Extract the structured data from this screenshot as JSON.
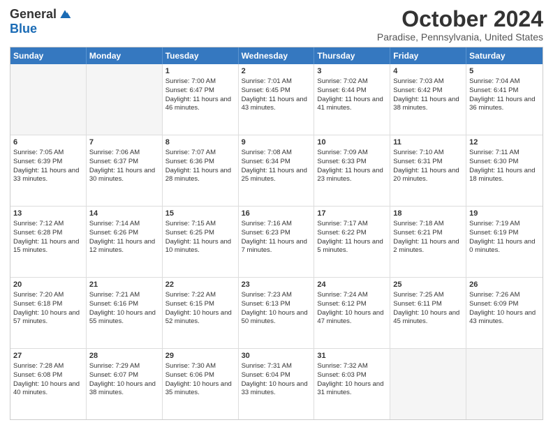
{
  "header": {
    "logo_general": "General",
    "logo_blue": "Blue",
    "month_title": "October 2024",
    "location": "Paradise, Pennsylvania, United States"
  },
  "days_of_week": [
    "Sunday",
    "Monday",
    "Tuesday",
    "Wednesday",
    "Thursday",
    "Friday",
    "Saturday"
  ],
  "weeks": [
    [
      {
        "day": "",
        "sunrise": "",
        "sunset": "",
        "daylight": "",
        "empty": true
      },
      {
        "day": "",
        "sunrise": "",
        "sunset": "",
        "daylight": "",
        "empty": true
      },
      {
        "day": "1",
        "sunrise": "Sunrise: 7:00 AM",
        "sunset": "Sunset: 6:47 PM",
        "daylight": "Daylight: 11 hours and 46 minutes."
      },
      {
        "day": "2",
        "sunrise": "Sunrise: 7:01 AM",
        "sunset": "Sunset: 6:45 PM",
        "daylight": "Daylight: 11 hours and 43 minutes."
      },
      {
        "day": "3",
        "sunrise": "Sunrise: 7:02 AM",
        "sunset": "Sunset: 6:44 PM",
        "daylight": "Daylight: 11 hours and 41 minutes."
      },
      {
        "day": "4",
        "sunrise": "Sunrise: 7:03 AM",
        "sunset": "Sunset: 6:42 PM",
        "daylight": "Daylight: 11 hours and 38 minutes."
      },
      {
        "day": "5",
        "sunrise": "Sunrise: 7:04 AM",
        "sunset": "Sunset: 6:41 PM",
        "daylight": "Daylight: 11 hours and 36 minutes."
      }
    ],
    [
      {
        "day": "6",
        "sunrise": "Sunrise: 7:05 AM",
        "sunset": "Sunset: 6:39 PM",
        "daylight": "Daylight: 11 hours and 33 minutes."
      },
      {
        "day": "7",
        "sunrise": "Sunrise: 7:06 AM",
        "sunset": "Sunset: 6:37 PM",
        "daylight": "Daylight: 11 hours and 30 minutes."
      },
      {
        "day": "8",
        "sunrise": "Sunrise: 7:07 AM",
        "sunset": "Sunset: 6:36 PM",
        "daylight": "Daylight: 11 hours and 28 minutes."
      },
      {
        "day": "9",
        "sunrise": "Sunrise: 7:08 AM",
        "sunset": "Sunset: 6:34 PM",
        "daylight": "Daylight: 11 hours and 25 minutes."
      },
      {
        "day": "10",
        "sunrise": "Sunrise: 7:09 AM",
        "sunset": "Sunset: 6:33 PM",
        "daylight": "Daylight: 11 hours and 23 minutes."
      },
      {
        "day": "11",
        "sunrise": "Sunrise: 7:10 AM",
        "sunset": "Sunset: 6:31 PM",
        "daylight": "Daylight: 11 hours and 20 minutes."
      },
      {
        "day": "12",
        "sunrise": "Sunrise: 7:11 AM",
        "sunset": "Sunset: 6:30 PM",
        "daylight": "Daylight: 11 hours and 18 minutes."
      }
    ],
    [
      {
        "day": "13",
        "sunrise": "Sunrise: 7:12 AM",
        "sunset": "Sunset: 6:28 PM",
        "daylight": "Daylight: 11 hours and 15 minutes."
      },
      {
        "day": "14",
        "sunrise": "Sunrise: 7:14 AM",
        "sunset": "Sunset: 6:26 PM",
        "daylight": "Daylight: 11 hours and 12 minutes."
      },
      {
        "day": "15",
        "sunrise": "Sunrise: 7:15 AM",
        "sunset": "Sunset: 6:25 PM",
        "daylight": "Daylight: 11 hours and 10 minutes."
      },
      {
        "day": "16",
        "sunrise": "Sunrise: 7:16 AM",
        "sunset": "Sunset: 6:23 PM",
        "daylight": "Daylight: 11 hours and 7 minutes."
      },
      {
        "day": "17",
        "sunrise": "Sunrise: 7:17 AM",
        "sunset": "Sunset: 6:22 PM",
        "daylight": "Daylight: 11 hours and 5 minutes."
      },
      {
        "day": "18",
        "sunrise": "Sunrise: 7:18 AM",
        "sunset": "Sunset: 6:21 PM",
        "daylight": "Daylight: 11 hours and 2 minutes."
      },
      {
        "day": "19",
        "sunrise": "Sunrise: 7:19 AM",
        "sunset": "Sunset: 6:19 PM",
        "daylight": "Daylight: 11 hours and 0 minutes."
      }
    ],
    [
      {
        "day": "20",
        "sunrise": "Sunrise: 7:20 AM",
        "sunset": "Sunset: 6:18 PM",
        "daylight": "Daylight: 10 hours and 57 minutes."
      },
      {
        "day": "21",
        "sunrise": "Sunrise: 7:21 AM",
        "sunset": "Sunset: 6:16 PM",
        "daylight": "Daylight: 10 hours and 55 minutes."
      },
      {
        "day": "22",
        "sunrise": "Sunrise: 7:22 AM",
        "sunset": "Sunset: 6:15 PM",
        "daylight": "Daylight: 10 hours and 52 minutes."
      },
      {
        "day": "23",
        "sunrise": "Sunrise: 7:23 AM",
        "sunset": "Sunset: 6:13 PM",
        "daylight": "Daylight: 10 hours and 50 minutes."
      },
      {
        "day": "24",
        "sunrise": "Sunrise: 7:24 AM",
        "sunset": "Sunset: 6:12 PM",
        "daylight": "Daylight: 10 hours and 47 minutes."
      },
      {
        "day": "25",
        "sunrise": "Sunrise: 7:25 AM",
        "sunset": "Sunset: 6:11 PM",
        "daylight": "Daylight: 10 hours and 45 minutes."
      },
      {
        "day": "26",
        "sunrise": "Sunrise: 7:26 AM",
        "sunset": "Sunset: 6:09 PM",
        "daylight": "Daylight: 10 hours and 43 minutes."
      }
    ],
    [
      {
        "day": "27",
        "sunrise": "Sunrise: 7:28 AM",
        "sunset": "Sunset: 6:08 PM",
        "daylight": "Daylight: 10 hours and 40 minutes."
      },
      {
        "day": "28",
        "sunrise": "Sunrise: 7:29 AM",
        "sunset": "Sunset: 6:07 PM",
        "daylight": "Daylight: 10 hours and 38 minutes."
      },
      {
        "day": "29",
        "sunrise": "Sunrise: 7:30 AM",
        "sunset": "Sunset: 6:06 PM",
        "daylight": "Daylight: 10 hours and 35 minutes."
      },
      {
        "day": "30",
        "sunrise": "Sunrise: 7:31 AM",
        "sunset": "Sunset: 6:04 PM",
        "daylight": "Daylight: 10 hours and 33 minutes."
      },
      {
        "day": "31",
        "sunrise": "Sunrise: 7:32 AM",
        "sunset": "Sunset: 6:03 PM",
        "daylight": "Daylight: 10 hours and 31 minutes."
      },
      {
        "day": "",
        "sunrise": "",
        "sunset": "",
        "daylight": "",
        "empty": true
      },
      {
        "day": "",
        "sunrise": "",
        "sunset": "",
        "daylight": "",
        "empty": true
      }
    ]
  ]
}
